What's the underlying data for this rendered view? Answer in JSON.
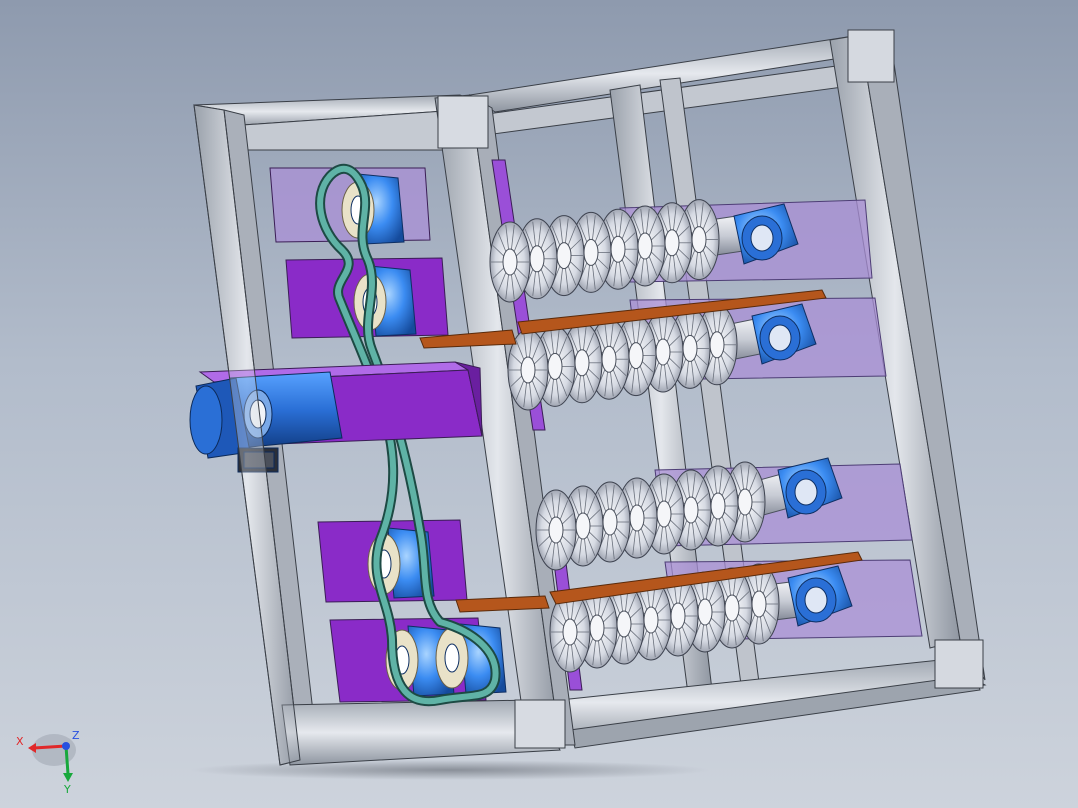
{
  "viewport": {
    "background_top": "#8e9aae",
    "background_bottom": "#cdd3dc"
  },
  "model": {
    "colors": {
      "frame": "#c9ced6",
      "frame_edge": "#3a3f47",
      "panel_purple": "#8a2bc8",
      "panel_lavender": "#a98fd6",
      "motor_blue": "#2a6fd6",
      "bearing_blue": "#3b8cf2",
      "belt_teal": "#5fb3a6",
      "gear_silver": "#dfe2ea",
      "plate_orange": "#b5561c"
    },
    "components": [
      "aluminum-extrusion-frame",
      "drive-motor",
      "motor-mount",
      "timing-belt",
      "pulleys",
      "flange-bearings",
      "bevel-gear-rollers",
      "guide-plates",
      "side-panels"
    ]
  },
  "triad": {
    "x_label": "X",
    "y_label": "Y",
    "z_label": "Z",
    "x_color": "#e0282a",
    "y_color": "#18a83c",
    "z_color": "#2850e0"
  }
}
